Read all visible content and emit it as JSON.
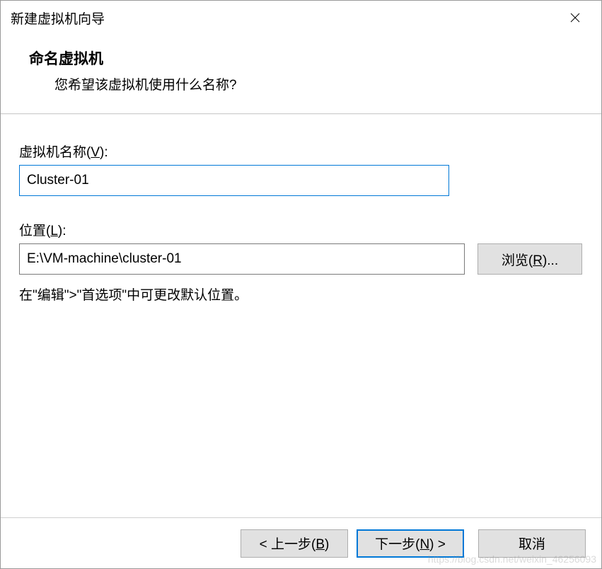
{
  "window": {
    "title": "新建虚拟机向导"
  },
  "header": {
    "title": "命名虚拟机",
    "subtitle": "您希望该虚拟机使用什么名称?"
  },
  "form": {
    "name_label_pre": "虚拟机名称(",
    "name_label_key": "V",
    "name_label_post": "):",
    "name_value": "Cluster-01",
    "location_label_pre": "位置(",
    "location_label_key": "L",
    "location_label_post": "):",
    "location_value": "E:\\VM-machine\\cluster-01",
    "browse_pre": "浏览(",
    "browse_key": "R",
    "browse_post": ")...",
    "hint": "在\"编辑\">\"首选项\"中可更改默认位置。"
  },
  "footer": {
    "back_pre": "< 上一步(",
    "back_key": "B",
    "back_post": ")",
    "next_pre": "下一步(",
    "next_key": "N",
    "next_post": ") >",
    "cancel": "取消"
  },
  "watermark": "https://blog.csdn.net/weixin_46256093"
}
